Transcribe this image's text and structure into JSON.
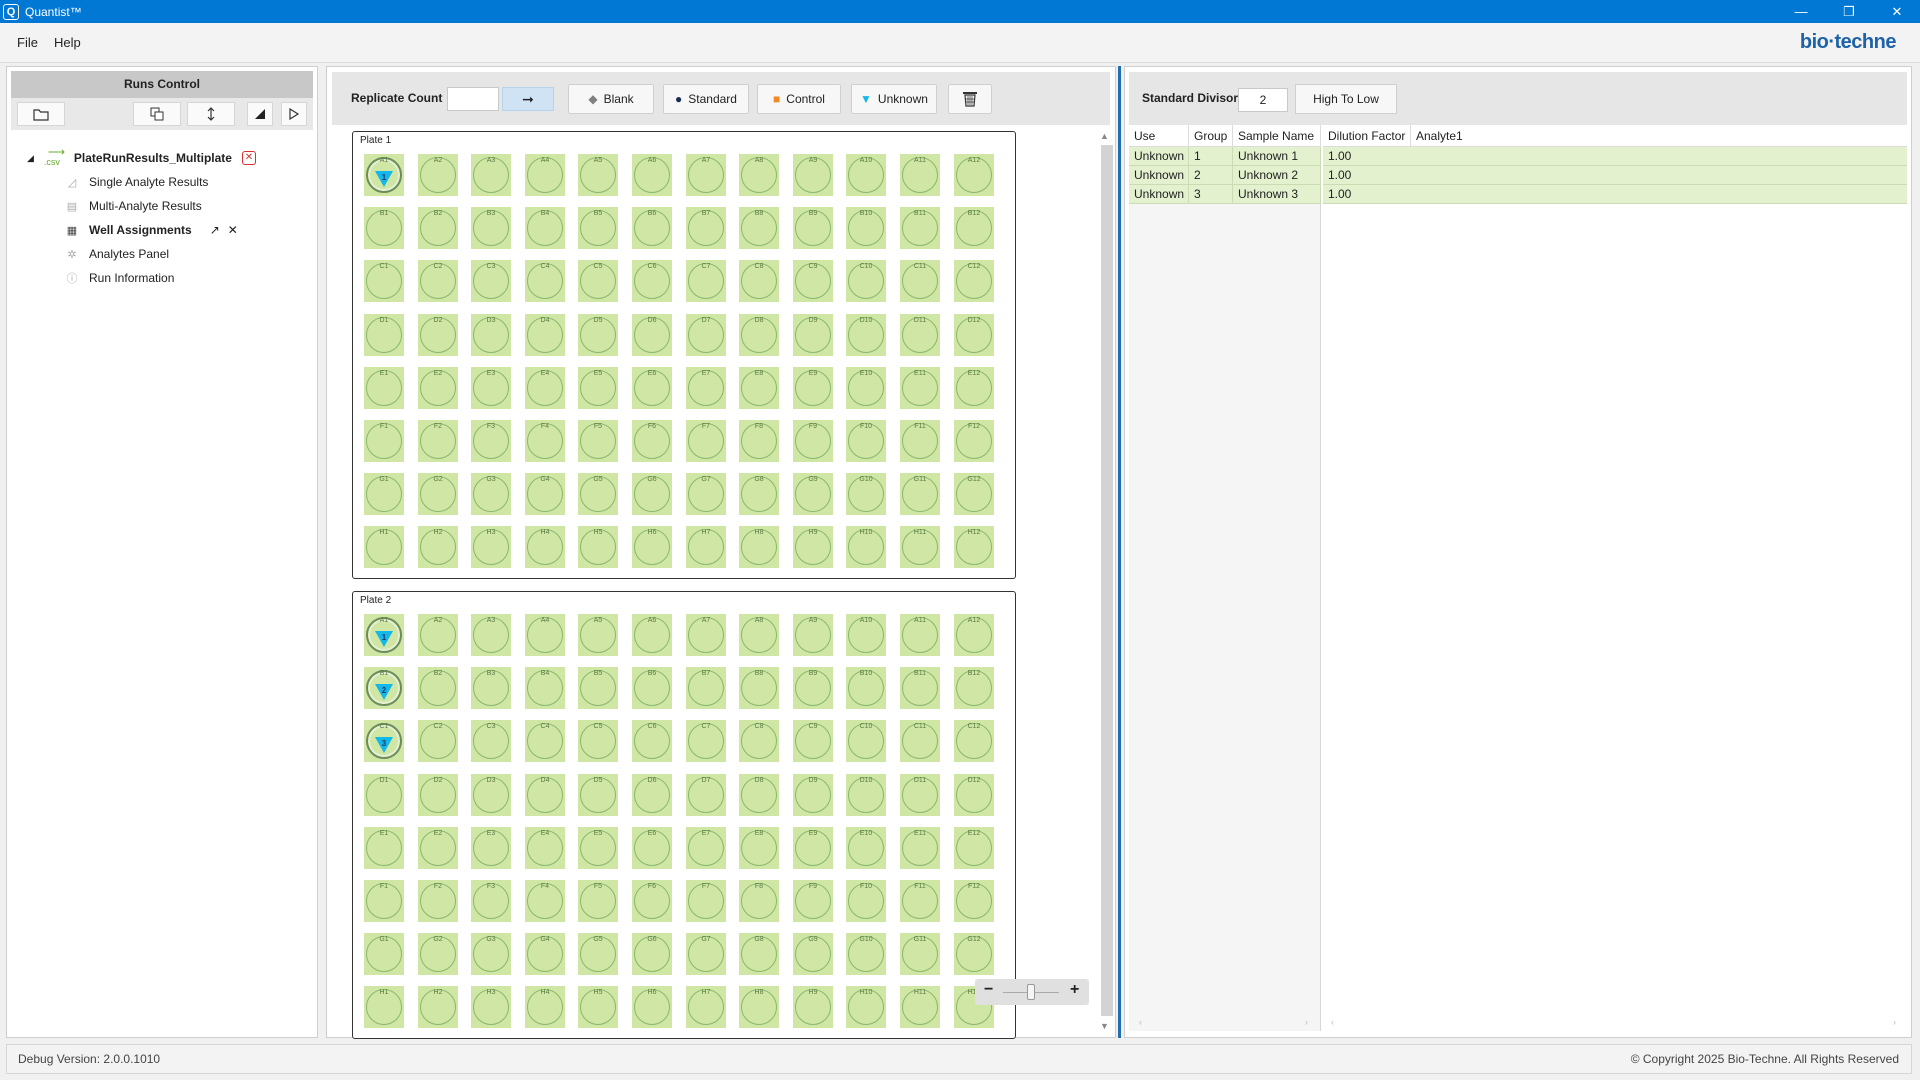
{
  "app": {
    "title": "Quantist™",
    "icon": "app-icon",
    "logo": "bio·techne"
  },
  "window_controls": {
    "minimize": "—",
    "restore": "❐",
    "close": "✕"
  },
  "menu": {
    "items": [
      "File",
      "Help"
    ]
  },
  "runs_control": {
    "header": "Runs Control",
    "toolbar_icons": [
      "open-folder-icon",
      "copy-icon",
      "sort-icon",
      "collapse-icon",
      "play-icon"
    ],
    "root": {
      "file_badge": ".csv",
      "label": "PlateRunResults_Multiplate",
      "close_icon": "close-badge-icon"
    },
    "children": [
      {
        "label": "Single Analyte Results",
        "icon": "chart-icon",
        "active": false
      },
      {
        "label": "Multi-Analyte Results",
        "icon": "document-icon",
        "active": false
      },
      {
        "label": "Well Assignments",
        "icon": "grid-icon",
        "active": true
      },
      {
        "label": "Analytes Panel",
        "icon": "network-icon",
        "active": false
      },
      {
        "label": "Run Information",
        "icon": "info-icon",
        "active": false
      }
    ]
  },
  "center_toolbar": {
    "replicate_label": "Replicate Count",
    "replicate_value": "",
    "apply_arrow": "➞",
    "buttons": [
      {
        "label": "Blank",
        "symbol": "◆",
        "color": "#808080"
      },
      {
        "label": "Standard",
        "symbol": "●",
        "color": "#1a2a50"
      },
      {
        "label": "Control",
        "symbol": "■",
        "color": "#f08a24"
      },
      {
        "label": "Unknown",
        "symbol": "▼",
        "color": "#14b8e8"
      }
    ],
    "clear_icon": "trash-grid-icon"
  },
  "plates": [
    {
      "title": "Plate 1",
      "rows": [
        "A",
        "B",
        "C",
        "D",
        "E",
        "F",
        "G",
        "H"
      ],
      "cols": 12,
      "assignments": [
        {
          "well": "A1",
          "group": "1"
        }
      ]
    },
    {
      "title": "Plate 2",
      "rows": [
        "A",
        "B",
        "C",
        "D",
        "E",
        "F",
        "G",
        "H"
      ],
      "cols": 12,
      "assignments": [
        {
          "well": "A1",
          "group": "1"
        },
        {
          "well": "B1",
          "group": "2"
        },
        {
          "well": "C1",
          "group": "3"
        }
      ]
    }
  ],
  "zoom": {
    "minus": "−",
    "plus": "+",
    "level": 0.5
  },
  "right_toolbar": {
    "divisor_label": "Standard Divisor",
    "divisor_value": "2",
    "order_button": "High To Low"
  },
  "samples_table": {
    "columns": [
      "Use",
      "Group",
      "Sample Name"
    ],
    "rows": [
      {
        "use": "Unknown",
        "group": "1",
        "name": "Unknown 1"
      },
      {
        "use": "Unknown",
        "group": "2",
        "name": "Unknown 2"
      },
      {
        "use": "Unknown",
        "group": "3",
        "name": "Unknown 3"
      }
    ]
  },
  "dilution_table": {
    "columns": [
      "Dilution Factor",
      "Analyte1"
    ],
    "rows": [
      {
        "dilution": "1.00"
      },
      {
        "dilution": "1.00"
      },
      {
        "dilution": "1.00"
      }
    ]
  },
  "status": {
    "version": "Debug Version: 2.0.0.1010",
    "copyright": "© Copyright 2025 Bio-Techne. All Rights Reserved"
  }
}
